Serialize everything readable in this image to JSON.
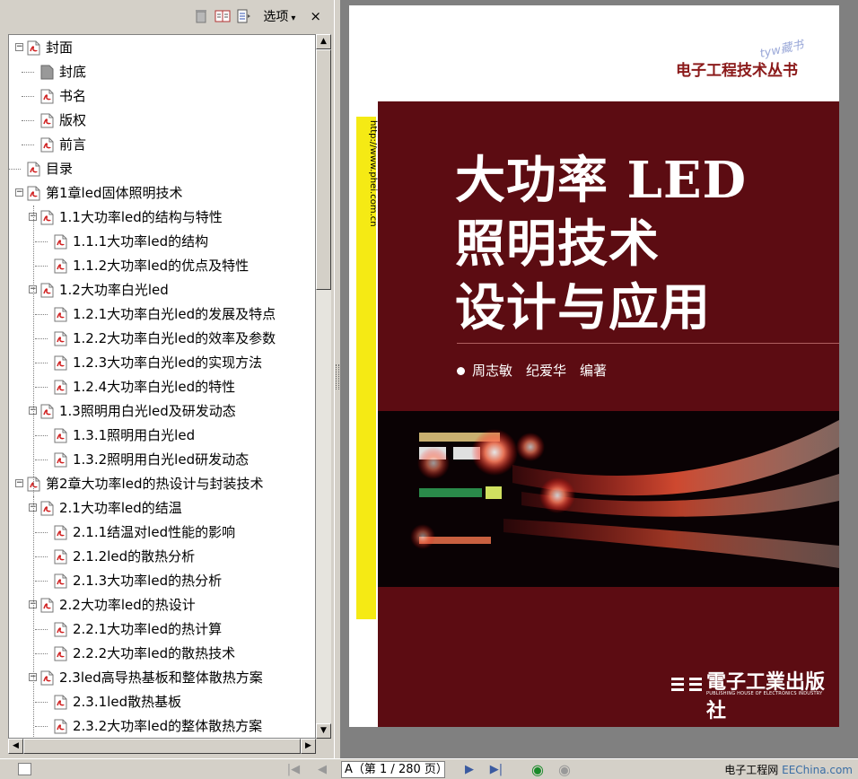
{
  "toolbar": {
    "options_label": "选项",
    "options_arrow": "▾",
    "close_label": "×"
  },
  "tree": [
    {
      "label": "封面",
      "level": 0,
      "toggle": "−"
    },
    {
      "label": "封底",
      "level": 1,
      "toggle": "",
      "icon": "gray"
    },
    {
      "label": "书名",
      "level": 1,
      "toggle": ""
    },
    {
      "label": "版权",
      "level": 1,
      "toggle": ""
    },
    {
      "label": "前言",
      "level": 1,
      "toggle": ""
    },
    {
      "label": "目录",
      "level": 0,
      "toggle": ""
    },
    {
      "label": "第1章led固体照明技术",
      "level": 0,
      "toggle": "−"
    },
    {
      "label": "1.1大功率led的结构与特性",
      "level": 1,
      "toggle": "−"
    },
    {
      "label": "1.1.1大功率led的结构",
      "level": 2,
      "toggle": ""
    },
    {
      "label": "1.1.2大功率led的优点及特性",
      "level": 2,
      "toggle": ""
    },
    {
      "label": "1.2大功率白光led",
      "level": 1,
      "toggle": "−"
    },
    {
      "label": "1.2.1大功率白光led的发展及特点",
      "level": 2,
      "toggle": ""
    },
    {
      "label": "1.2.2大功率白光led的效率及参数",
      "level": 2,
      "toggle": ""
    },
    {
      "label": "1.2.3大功率白光led的实现方法",
      "level": 2,
      "toggle": ""
    },
    {
      "label": "1.2.4大功率白光led的特性",
      "level": 2,
      "toggle": ""
    },
    {
      "label": "1.3照明用白光led及研发动态",
      "level": 1,
      "toggle": "−"
    },
    {
      "label": "1.3.1照明用白光led",
      "level": 2,
      "toggle": ""
    },
    {
      "label": "1.3.2照明用白光led研发动态",
      "level": 2,
      "toggle": ""
    },
    {
      "label": "第2章大功率led的热设计与封装技术",
      "level": 0,
      "toggle": "−"
    },
    {
      "label": "2.1大功率led的结温",
      "level": 1,
      "toggle": "−"
    },
    {
      "label": "2.1.1结温对led性能的影响",
      "level": 2,
      "toggle": ""
    },
    {
      "label": "2.1.2led的散热分析",
      "level": 2,
      "toggle": ""
    },
    {
      "label": "2.1.3大功率led的热分析",
      "level": 2,
      "toggle": ""
    },
    {
      "label": "2.2大功率led的热设计",
      "level": 1,
      "toggle": "−"
    },
    {
      "label": "2.2.1大功率led的热计算",
      "level": 2,
      "toggle": ""
    },
    {
      "label": "2.2.2大功率led的散热技术",
      "level": 2,
      "toggle": ""
    },
    {
      "label": "2.3led高导热基板和整体散热方案",
      "level": 1,
      "toggle": "−"
    },
    {
      "label": "2.3.1led散热基板",
      "level": 2,
      "toggle": ""
    },
    {
      "label": "2.3.2大功率led的整体散热方案",
      "level": 2,
      "toggle": ""
    }
  ],
  "cover": {
    "series": "电子工程技术丛书",
    "watermark": "tyw藏书",
    "url": "http://www.phei.com.cn",
    "title_line1": "大功率 LED",
    "title_line2": "照明技术",
    "title_line3": "设计与应用",
    "authors": "周志敏　纪爱华　编著",
    "publisher": "電子工業出版社",
    "publisher_en": "PUBLISHING HOUSE OF ELECTRONICS INDUSTRY"
  },
  "statusbar": {
    "page_field": "A（第 1 / 280 页）",
    "credit_main": "电子工程网",
    "credit_site": "EEChina.com"
  },
  "colors": {
    "cover_red": "#5c0c12",
    "spine_yellow": "#f5ea14",
    "series_text": "#8b1a1a"
  }
}
